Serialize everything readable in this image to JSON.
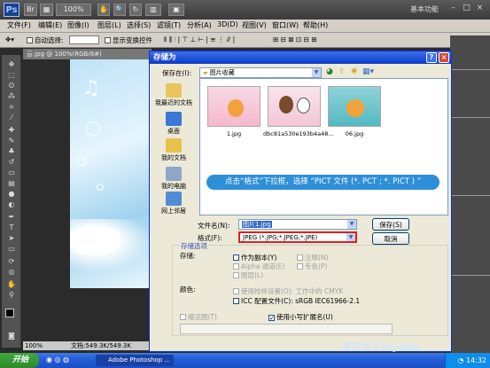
{
  "app": {
    "workspace_label": "基本功能",
    "zoom_value": "100%",
    "doc_tab": "云.jpg @ 100%(RGB/8#)",
    "status_zoom": "100%",
    "status_doc": "文档:549.3K/549.3K"
  },
  "menu": [
    "文件(F)",
    "编辑(E)",
    "图像(I)",
    "图层(L)",
    "选择(S)",
    "滤镜(T)",
    "分析(A)",
    "3D(D)",
    "视图(V)",
    "窗口(W)",
    "帮助(H)"
  ],
  "options": {
    "feather_label": "自动选择:",
    "transform_label": "显示变换控件"
  },
  "dialog": {
    "title": "存储为",
    "save_in_label": "保存在(I):",
    "save_in_value": "图片收藏",
    "places": [
      {
        "label": "我最近的文档",
        "color": "#e9c35c"
      },
      {
        "label": "桌面",
        "color": "#3a78d4"
      },
      {
        "label": "我的文档",
        "color": "#e6c24d"
      },
      {
        "label": "我的电脑",
        "color": "#8fa6c8"
      },
      {
        "label": "网上邻居",
        "color": "#4f8dd6"
      }
    ],
    "files": [
      {
        "name": "1.jpg"
      },
      {
        "name": "dbc81a530e193b4a48..."
      },
      {
        "name": "06.jpg"
      }
    ],
    "filename_label": "文件名(N):",
    "filename_value": "图片1.jpg",
    "format_label": "格式(F):",
    "format_value": "JPEG (*.JPG;*.JPEG;*.JPE)",
    "save_button": "保存(S)",
    "cancel_button": "取消",
    "save_options_title": "存储选项",
    "storage_label": "存储:",
    "as_copy": "作为副本(Y)",
    "notes": "注释(N)",
    "alpha": "Alpha 通道(E)",
    "spot": "专色(P)",
    "layers": "图层(L)",
    "color_label": "颜色:",
    "use_proof": "使用校样设置(O): 工作中的 CMYK",
    "icc_profile": "ICC 配置文件(C): sRGB IEC61966-2.1",
    "thumbnail": "缩览图(T)",
    "lowercase_ext": "使用小写扩展名(U)"
  },
  "callout_text": "点击“格式”下拉框，选择 “PICT 文件 (*. PCT ; *. PICT ) ”",
  "taskbar": {
    "start": "开始",
    "task_item": "Adobe Photoshop ...",
    "clock": "14:32"
  },
  "watermark": "考无忧 Easykao"
}
